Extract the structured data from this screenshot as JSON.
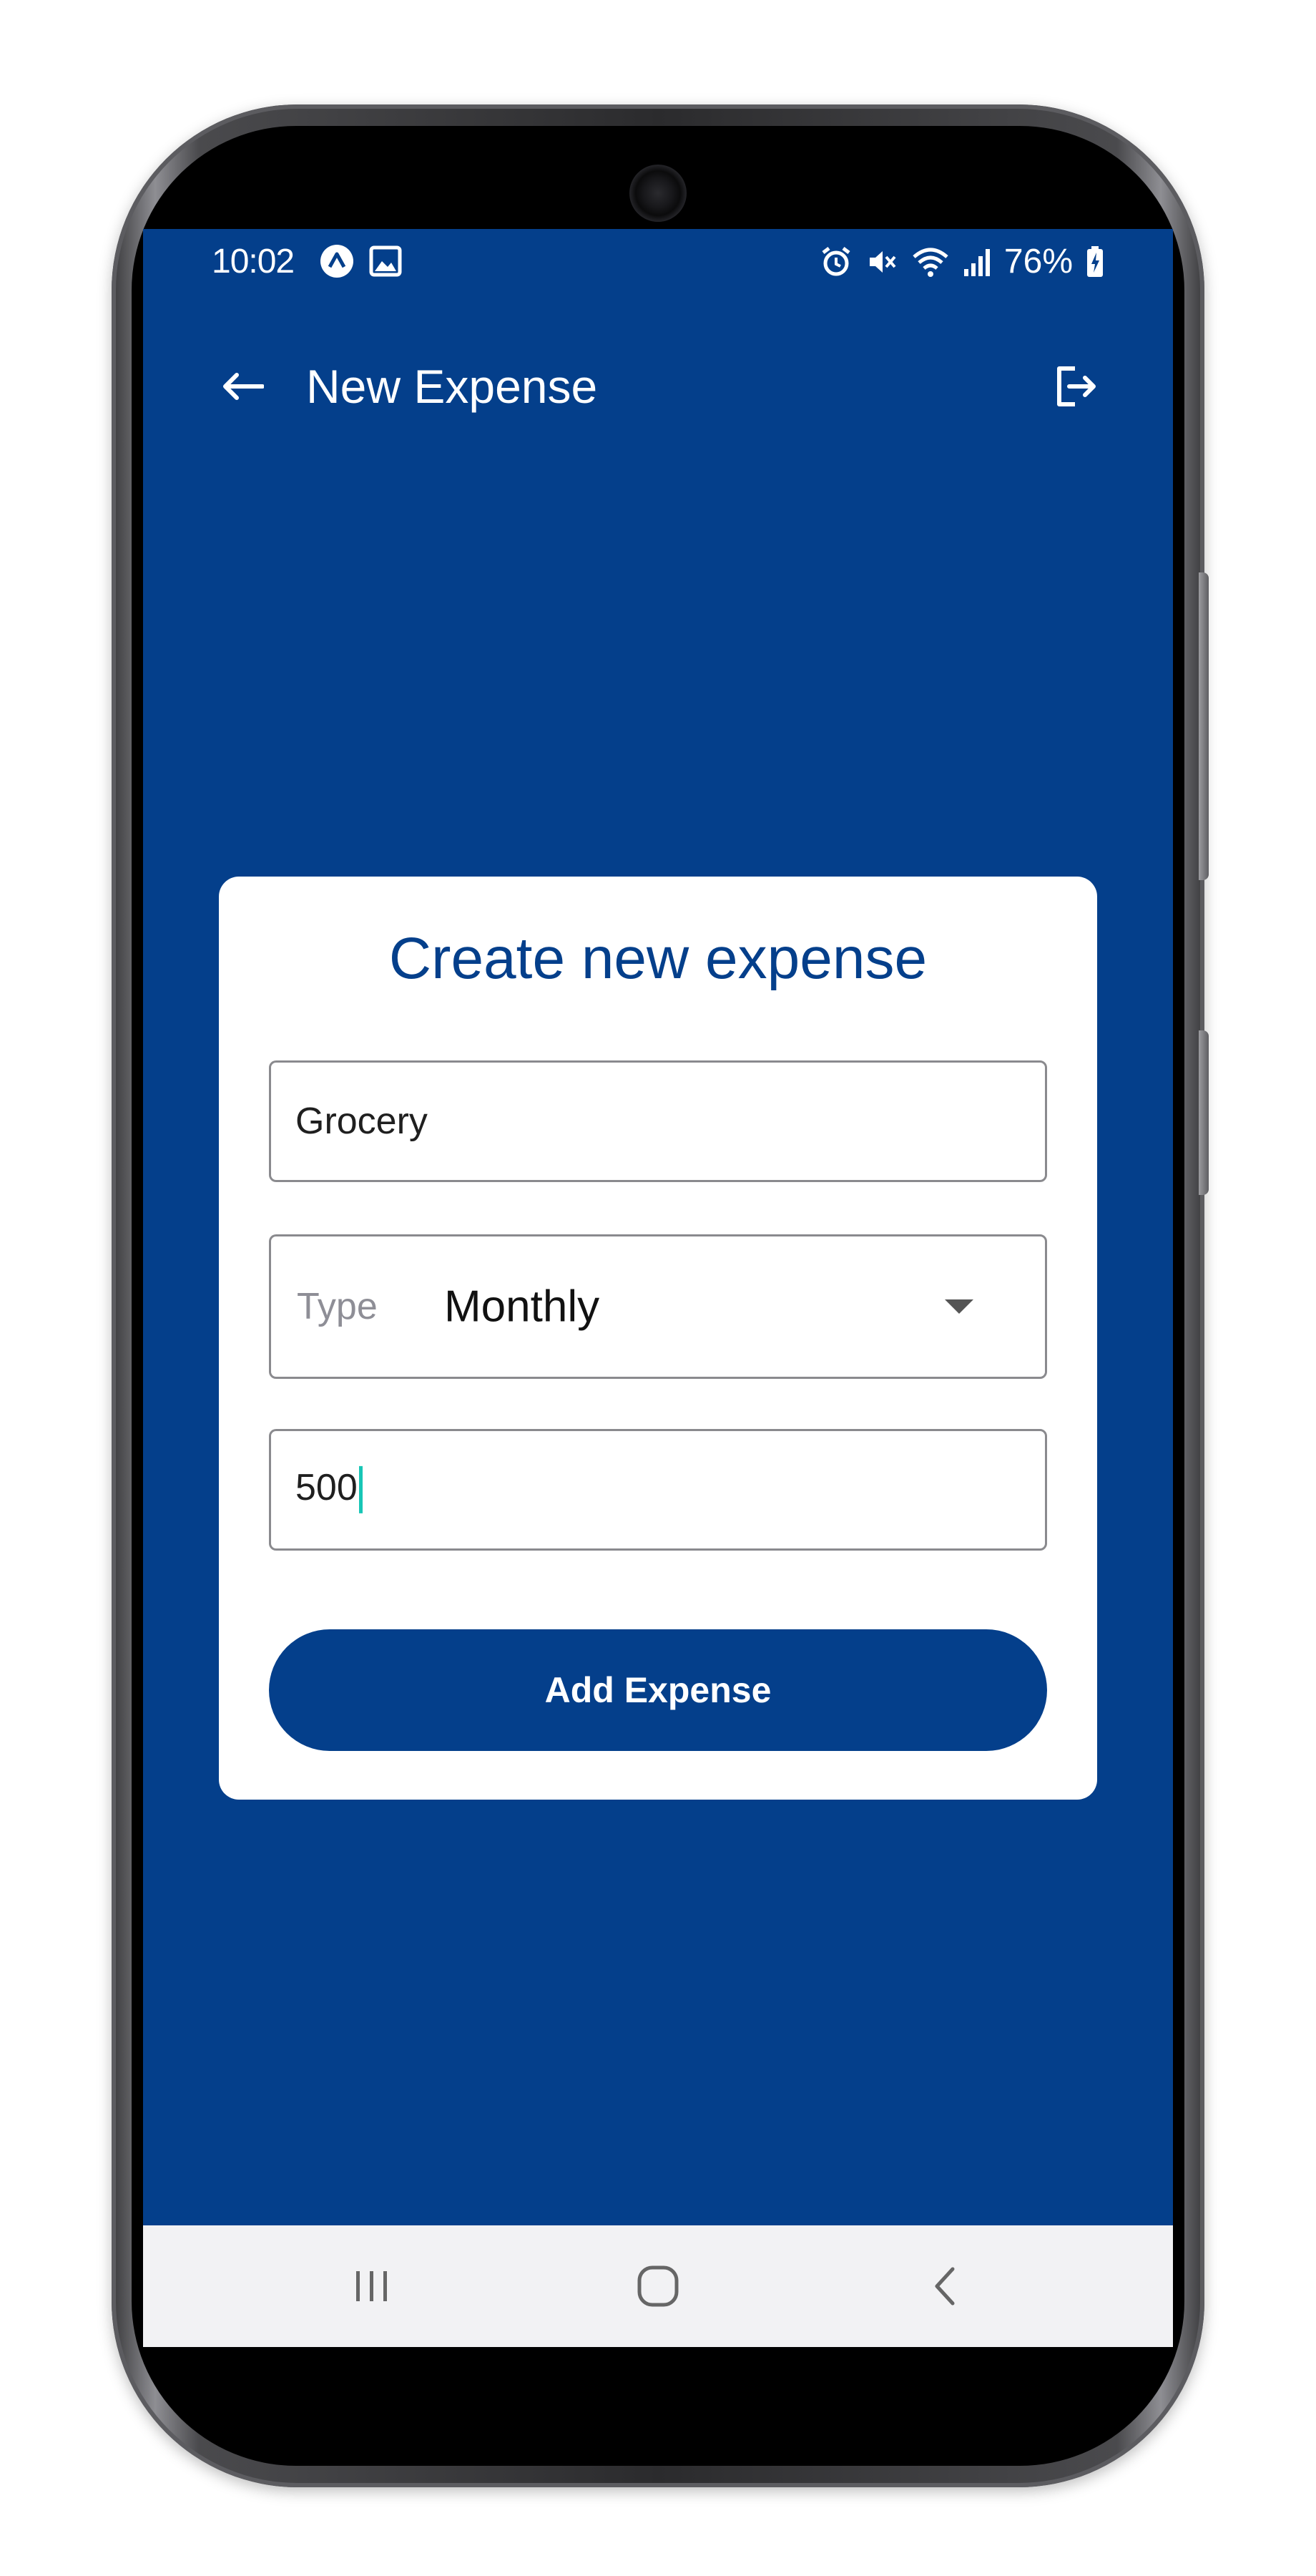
{
  "status_bar": {
    "time": "10:02",
    "battery": "76%",
    "left_icons": [
      "app-notification-icon",
      "image-icon"
    ],
    "right_icons": [
      "alarm-icon",
      "mute-icon",
      "wifi-icon",
      "signal-icon",
      "battery-charging-icon"
    ]
  },
  "app_bar": {
    "title": "New Expense",
    "back_icon": "arrow-back-icon",
    "logout_icon": "logout-icon"
  },
  "form": {
    "title": "Create new expense",
    "name_value": "Grocery",
    "type_label": "Type",
    "type_value": "Monthly",
    "amount_value": "500",
    "submit_label": "Add Expense"
  },
  "nav_bar": {
    "items": [
      "recents-icon",
      "home-icon",
      "back-icon"
    ]
  },
  "colors": {
    "primary": "#043f8b",
    "card": "#ffffff",
    "cursor": "#18c6b6",
    "nav_bar": "#f2f2f4"
  }
}
